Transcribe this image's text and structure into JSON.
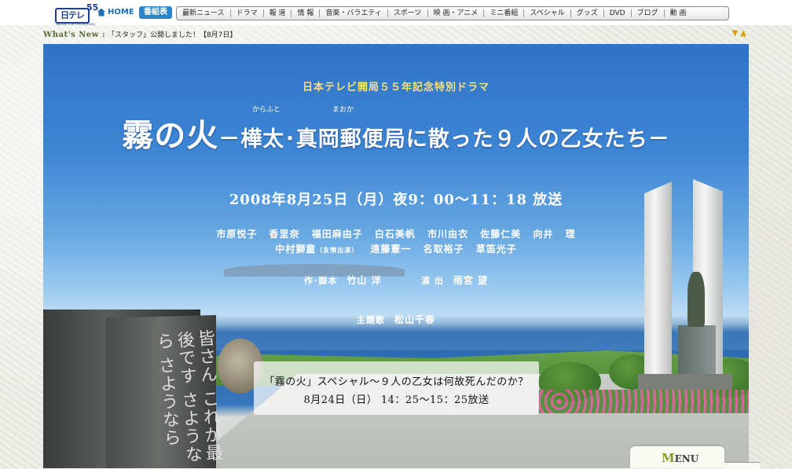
{
  "header": {
    "logo_text": "日テレ",
    "logo_number": "55",
    "logo_sub": "Nittele 55th Anniversary",
    "home_label": "HOME",
    "bangumi_label": "番組表",
    "nav_items": [
      "最新ニュース",
      "ドラマ",
      "報 道",
      "情 報",
      "音楽・バラエティ",
      "スポーツ",
      "映 画・アニメ",
      "ミニ番組",
      "スペシャル",
      "グッズ",
      "DVD",
      "ブログ",
      "動 画"
    ]
  },
  "whats_new": {
    "label": "What's New :",
    "text": "「スタッフ」公開しました！【8月7日】",
    "arrows": "▼▲"
  },
  "banner": {
    "subtitle": "日本テレビ開局５５年記念特別ドラマ",
    "title_main": "霧の火",
    "title_sub": "－樺太･真岡郵便局に散った９人の乙女たち－",
    "ruby_1": "からふと",
    "ruby_2": "まおか",
    "broadcast": "2008年8月25日（月）夜9：00～11：18 放送",
    "cast_line1": "市原悦子 香里奈 福田麻由子 白石美帆 市川由衣 佐藤仁美 向井 理",
    "cast_line2_a": "中村獅童",
    "cast_line2_note": "（友情出演）",
    "cast_line2_b": "遠藤憲一 名取裕子 草笛光子",
    "writer_label": "作･脚本",
    "writer": "竹山 洋",
    "director_label": "演 出",
    "director": "雨宮 望",
    "theme_label": "主題歌",
    "theme_singer": "松山千春",
    "monument_inscription": "皆さん これが最後です さようなら さようなら"
  },
  "special": {
    "line1": "「霧の火」スペシャル～９人の乙女は何故死んだのか？",
    "line2": "8月24日（日） 14：25～15：25放送"
  },
  "menu_tab": {
    "initial": "M",
    "rest": "ENU"
  }
}
